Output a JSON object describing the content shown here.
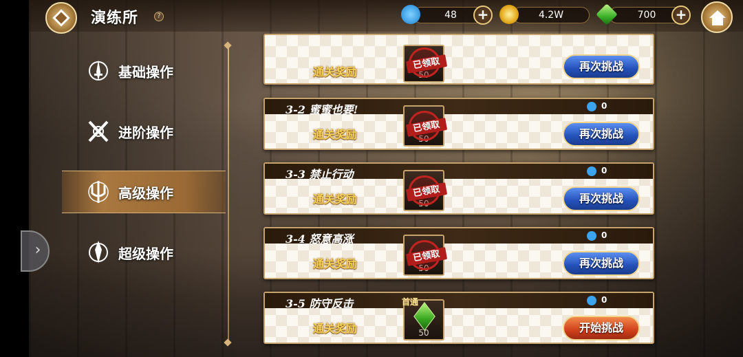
{
  "header": {
    "title": "演练所",
    "help_glyph": "?"
  },
  "resources": [
    {
      "icon": "shrimp-icon",
      "value": "48"
    },
    {
      "icon": "gold-coin-icon",
      "value": "4.2W"
    },
    {
      "icon": "green-gem-icon",
      "value": "700"
    }
  ],
  "sidebar": {
    "items": [
      {
        "label": "基础操作",
        "icon": "sword-emblem-icon",
        "active": false
      },
      {
        "label": "进阶操作",
        "icon": "crossed-swords-icon",
        "active": false
      },
      {
        "label": "高级操作",
        "icon": "trident-emblem-icon",
        "active": true
      },
      {
        "label": "超级操作",
        "icon": "spear-emblem-icon",
        "active": false
      }
    ]
  },
  "stages": [
    {
      "name": "",
      "count": "",
      "reward_label": "通关奖励",
      "reward_qty": "50",
      "claimed_text": "已领取",
      "action": "再次挑战"
    },
    {
      "name": "3-2 蜜蜜也要!",
      "count": "0",
      "reward_label": "通关奖励",
      "reward_qty": "50",
      "claimed_text": "已领取",
      "action": "再次挑战"
    },
    {
      "name": "3-3 禁止行动",
      "count": "0",
      "reward_label": "通关奖励",
      "reward_qty": "50",
      "claimed_text": "已领取",
      "action": "再次挑战"
    },
    {
      "name": "3-4 怒意高涨",
      "count": "0",
      "reward_label": "通关奖励",
      "reward_qty": "50",
      "claimed_text": "已领取",
      "action": "再次挑战"
    },
    {
      "name": "3-5 防守反击",
      "count": "0",
      "reward_label": "通关奖励",
      "reward_qty": "50",
      "first_clear": "首通",
      "action": "开始挑战"
    }
  ],
  "colors": {
    "accent_gold": "#c7a46c",
    "button_blue": "#2350b8",
    "button_red": "#d2401c",
    "reward_text": "#f6d15c"
  }
}
